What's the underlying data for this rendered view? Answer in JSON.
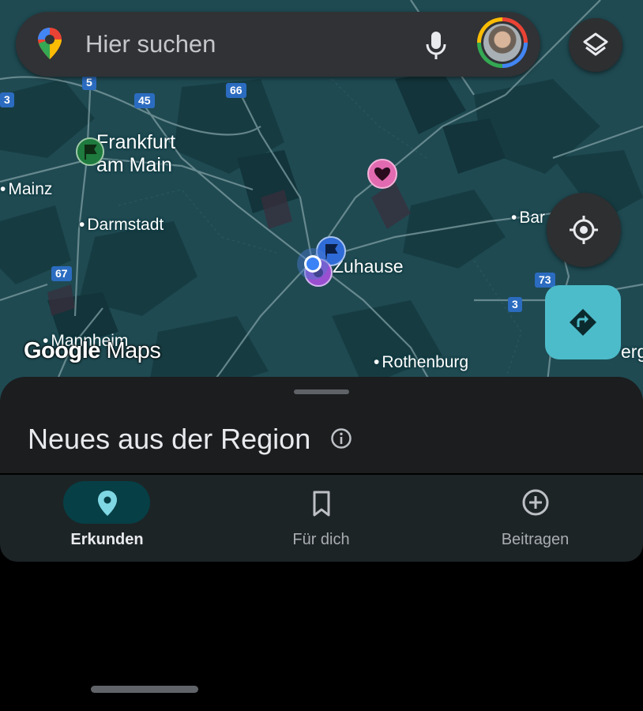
{
  "search": {
    "placeholder": "Hier suchen"
  },
  "map": {
    "attribution": "Google Maps",
    "places": [
      {
        "name": "Frankfurt am Main",
        "line1": "Frankfurt",
        "line2": "am Main"
      },
      {
        "name": "Mainz"
      },
      {
        "name": "Darmstadt"
      },
      {
        "name": "Zuhause"
      },
      {
        "name": "Bar"
      },
      {
        "name": "Mannheim"
      },
      {
        "name": "Rothenburg"
      },
      {
        "name": "erg"
      }
    ],
    "road_shields": [
      "5",
      "45",
      "66",
      "3",
      "67",
      "73",
      "3"
    ],
    "colors": {
      "land": "#1f4a52",
      "forest": "#143a40",
      "roads": "#7f9ea3",
      "home_pin": "#2f6bd6",
      "heart_pin": "#e26ab0",
      "saved_flag": "#1e7a3e",
      "directions_button": "#4dbcca"
    }
  },
  "icons": {
    "maps_pin": "google-maps-pin-icon",
    "mic": "mic-icon",
    "layers": "layers-icon",
    "locate": "my-location-icon",
    "directions": "directions-icon",
    "info": "info-icon"
  },
  "sheet": {
    "title": "Neues aus der Region"
  },
  "nav": {
    "items": [
      {
        "label": "Erkunden",
        "icon": "location-pin-icon",
        "active": true
      },
      {
        "label": "Für dich",
        "icon": "bookmark-icon",
        "active": false
      },
      {
        "label": "Beitragen",
        "icon": "add-circle-icon",
        "active": false
      }
    ]
  }
}
